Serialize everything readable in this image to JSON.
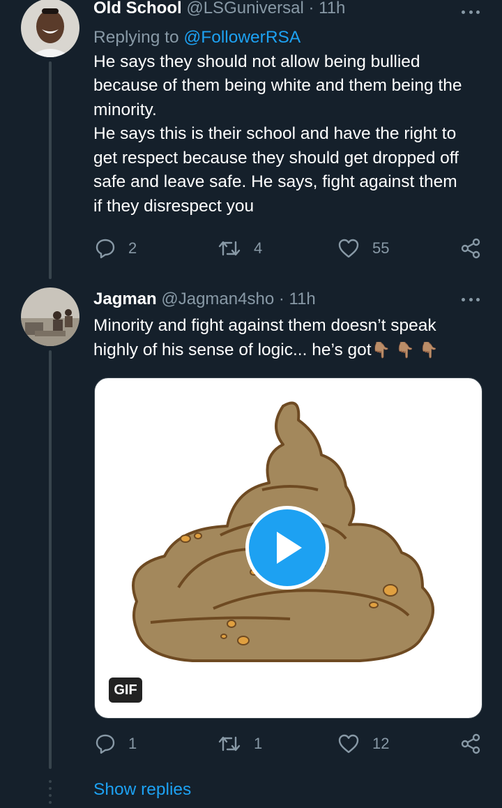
{
  "tweet1": {
    "name": "Old School",
    "handle": "@LSGuniversal",
    "separator": "·",
    "time": "11h",
    "replying_prefix": "Replying to ",
    "replying_to": "@FollowerRSA",
    "lines": [
      "He says they should not allow being bullied",
      "because of them being white and them being the",
      "minority.",
      "He says this is their school and have the right to",
      "get respect because they should get dropped off",
      "safe and leave safe. He says, fight against them",
      "if they disrespect you"
    ],
    "replies": "2",
    "retweets": "4",
    "likes": "55"
  },
  "tweet2": {
    "name": "Jagman",
    "handle": "@Jagman4sho",
    "separator": "·",
    "time": "11h",
    "lines": [
      "Minority and fight against them doesn’t speak",
      "highly of his sense of logic... he’s got"
    ],
    "emoji": "👇🏽 👇🏽 👇🏽",
    "gif_label": "GIF",
    "replies": "1",
    "retweets": "1",
    "likes": "12"
  },
  "show_replies": "Show replies",
  "icons": {
    "reply": "reply-icon",
    "retweet": "retweet-icon",
    "like": "heart-icon",
    "share": "share-icon",
    "more": "more-icon",
    "play": "play-icon"
  },
  "colors": {
    "background": "#15202b",
    "accent": "#1da1f2",
    "muted": "#8899a6"
  }
}
